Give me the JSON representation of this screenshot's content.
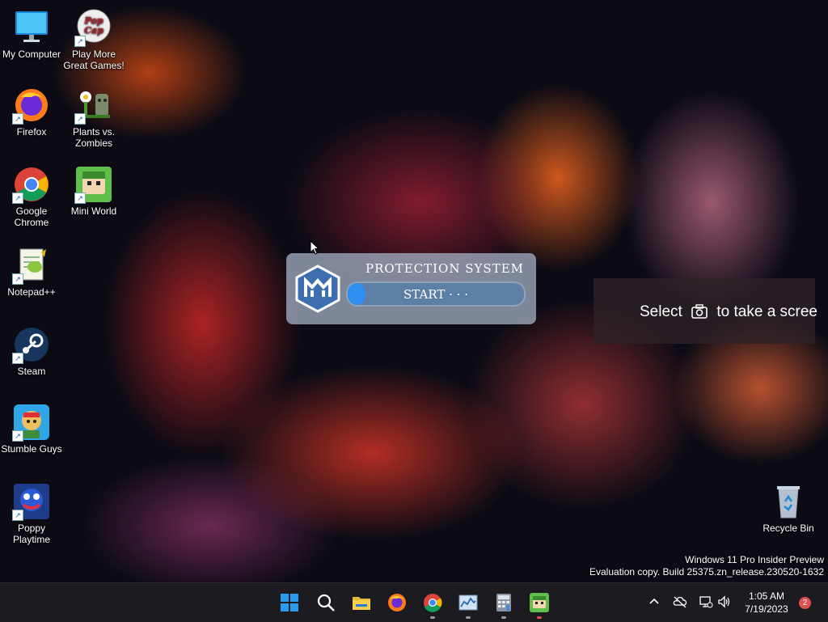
{
  "desktop": {
    "icons": [
      {
        "label": "My Computer",
        "icon": "monitor-icon"
      },
      {
        "label": "Play More Great Games!",
        "icon": "popcap-icon"
      },
      {
        "label": "Firefox",
        "icon": "firefox-icon"
      },
      {
        "label": "Plants vs. Zombies",
        "icon": "plants-vs-zombies-icon"
      },
      {
        "label": "Google Chrome",
        "icon": "chrome-icon"
      },
      {
        "label": "Mini World",
        "icon": "mini-world-icon"
      },
      {
        "label": "Notepad++",
        "icon": "notepad-plus-plus-icon"
      },
      {
        "label": "Steam",
        "icon": "steam-icon"
      },
      {
        "label": "Stumble Guys",
        "icon": "stumble-guys-icon"
      },
      {
        "label": "Poppy Playtime",
        "icon": "poppy-playtime-icon"
      },
      {
        "label": "Recycle Bin",
        "icon": "recycle-bin-icon"
      }
    ],
    "popcap_logo_text": "Pop Cap"
  },
  "protection_dialog": {
    "title": "PROTECTION SYSTEM",
    "status": "START · · ·",
    "progress_fraction": 0.1,
    "accent": "#2f8ff0"
  },
  "snip_toast": {
    "message_before": "Select",
    "message_after": "to take a scree",
    "icon": "camera-icon"
  },
  "watermark": {
    "line1": "Windows 11 Pro Insider Preview",
    "line2": "Evaluation copy. Build 25375.zn_release.230520-1632"
  },
  "taskbar": {
    "apps": [
      "start-icon",
      "search-icon",
      "file-explorer-icon",
      "firefox-icon",
      "chrome-icon",
      "task-manager-icon",
      "calculator-icon",
      "mini-world-icon"
    ],
    "tray": [
      "chevron-up-icon",
      "onedrive-offline-icon",
      "network-icon",
      "volume-icon"
    ],
    "time": "1:05 AM",
    "date": "7/19/2023",
    "notification_count": "2"
  }
}
